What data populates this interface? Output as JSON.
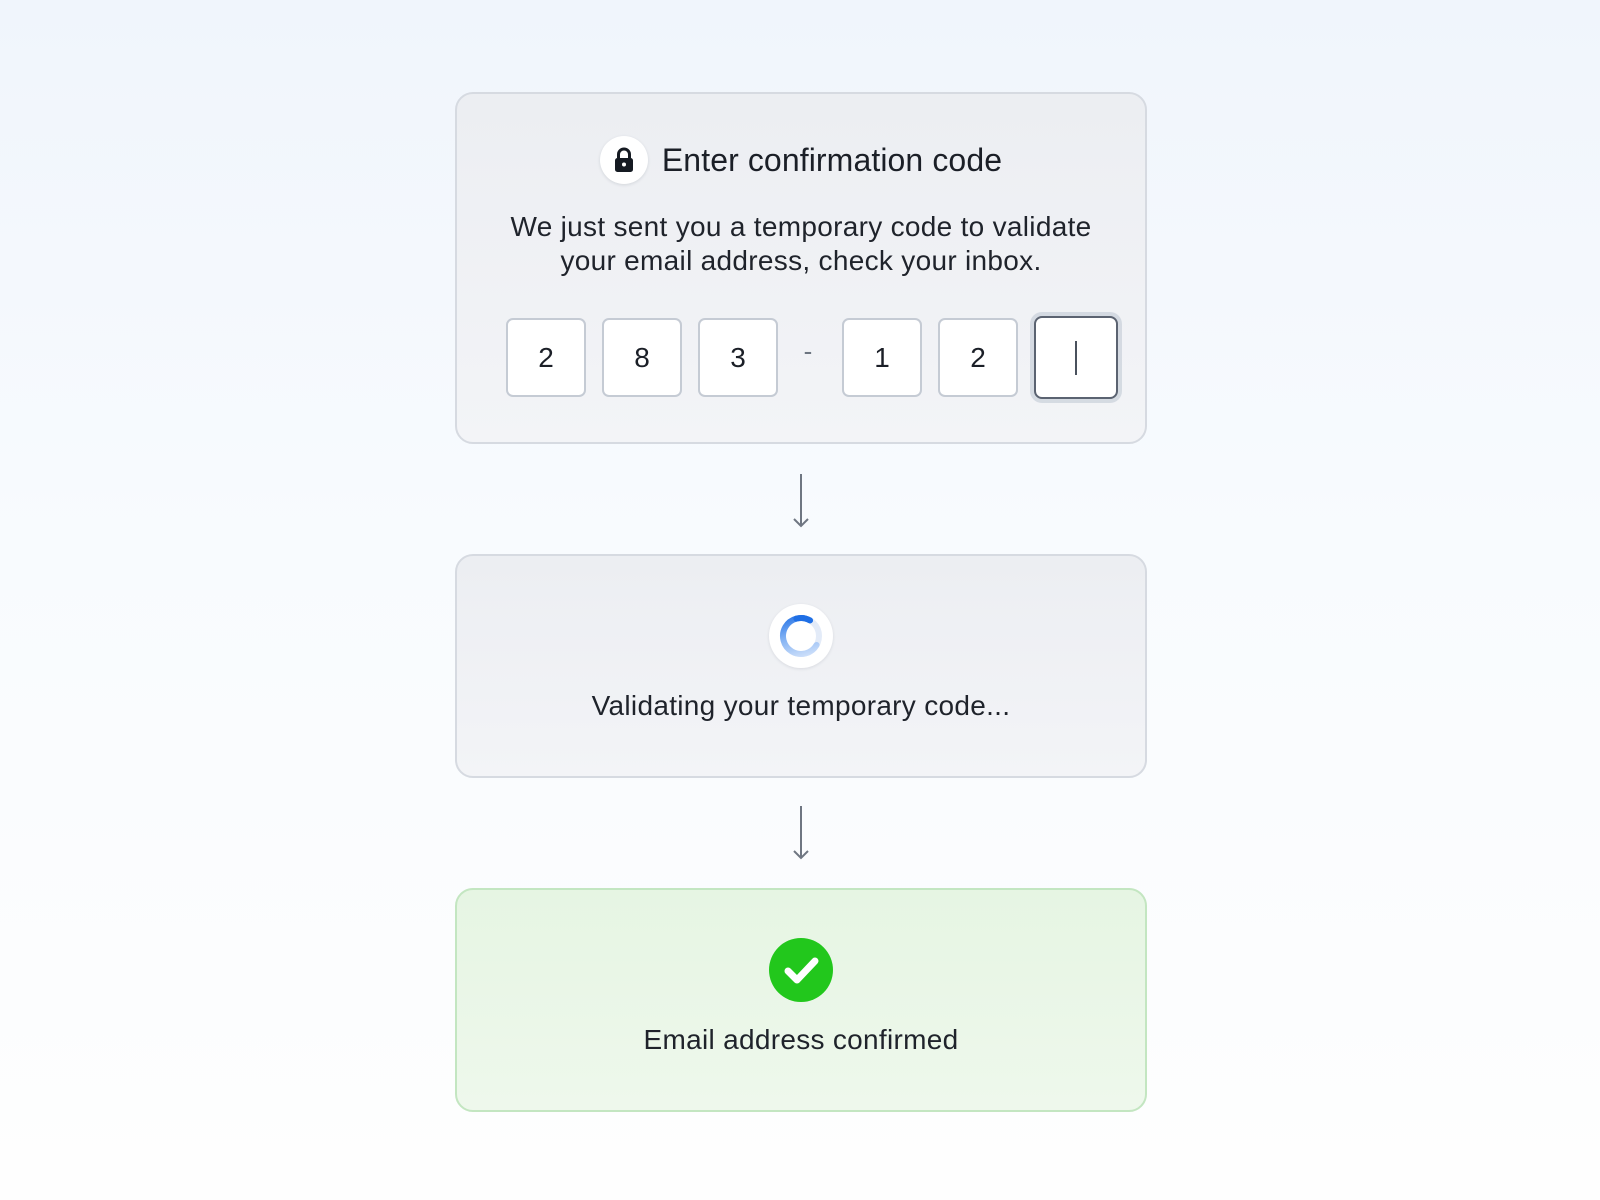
{
  "code_card": {
    "title": "Enter confirmation code",
    "lock_icon": "lock-icon",
    "instructions": "We just sent you a temporary code to validate your email address, check your inbox.",
    "digits": [
      "2",
      "8",
      "3",
      "1",
      "2",
      ""
    ],
    "separator": "-"
  },
  "validating_card": {
    "icon": "spinner-icon",
    "text": "Validating your temporary code..."
  },
  "confirmed_card": {
    "icon": "check-circle-icon",
    "text": "Email address confirmed"
  },
  "colors": {
    "spinner_accent": "#1f6fe5",
    "success_green": "#22c71c",
    "success_card_bg": "#e6f5e3"
  }
}
